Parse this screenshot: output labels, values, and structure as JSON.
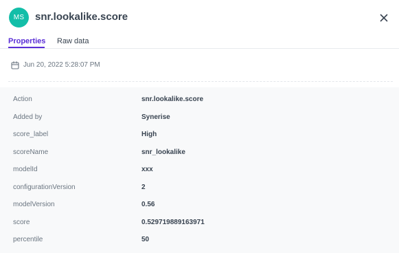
{
  "header": {
    "avatar_initials": "MS",
    "avatar_color": "#13bea8",
    "title": "snr.lookalike.score",
    "close_icon": "close-icon"
  },
  "tabs": [
    {
      "label": "Properties",
      "active": true
    },
    {
      "label": "Raw data",
      "active": false
    }
  ],
  "accent_color": "#5a2ed6",
  "event": {
    "datetime_icon": "calendar-icon",
    "datetime": "Jun 20, 2022 5:28:07 PM"
  },
  "properties": [
    {
      "key": "Action",
      "value": "snr.lookalike.score"
    },
    {
      "key": "Added by",
      "value": "Synerise"
    },
    {
      "key": "score_label",
      "value": "High"
    },
    {
      "key": "scoreName",
      "value": "snr_lookalike"
    },
    {
      "key": "modelId",
      "value": "xxx"
    },
    {
      "key": "configurationVersion",
      "value": "2"
    },
    {
      "key": "modelVersion",
      "value": "0.56"
    },
    {
      "key": "score",
      "value": "0.529719889163971"
    },
    {
      "key": "percentile",
      "value": "50"
    }
  ]
}
